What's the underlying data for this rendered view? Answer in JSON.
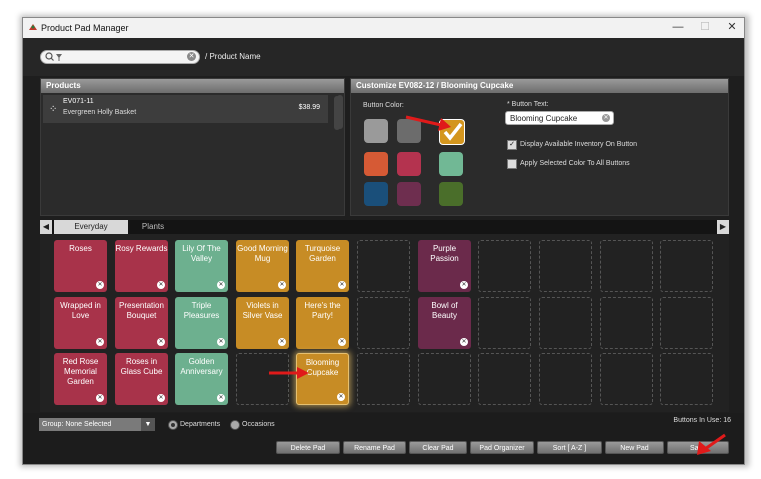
{
  "window": {
    "title": "Product Pad Manager",
    "controls": [
      "—",
      "☐",
      "✕"
    ]
  },
  "search": {
    "value": "",
    "placeholder": "",
    "label": "/ Product Name"
  },
  "products": {
    "header": "Products",
    "items": [
      {
        "code": "EV071-11",
        "name": "Evergreen Holly Basket",
        "price": "$38.99"
      }
    ]
  },
  "customize": {
    "header": "Customize EV082-12 / Blooming Cupcake",
    "button_color_label": "Button Color:",
    "swatches": [
      "#9a9a9a",
      "#6c6c6c",
      "#d4961e",
      "#d65a35",
      "#b4334f",
      "#71b895",
      "#1a4f7a",
      "#6e2e4f",
      "#4a6e2a"
    ],
    "selected_swatch": 2,
    "button_text_label": "* Button Text:",
    "button_text_value": "Blooming Cupcake",
    "display_inventory_label": "Display Available Inventory On Button",
    "display_inventory_checked": true,
    "apply_color_label": "Apply Selected Color To All Buttons",
    "apply_color_checked": false
  },
  "tabs": [
    {
      "label": "Everyday",
      "active": true
    },
    {
      "label": "Plants",
      "active": false
    }
  ],
  "pads": [
    {
      "label": "Roses",
      "color": "#a8334a",
      "row": 0,
      "col": 0
    },
    {
      "label": "Rosy Rewards",
      "color": "#a8334a",
      "row": 0,
      "col": 1
    },
    {
      "label": "Lily Of The Valley",
      "color": "#6db08f",
      "row": 0,
      "col": 2
    },
    {
      "label": "Good Morning Mug",
      "color": "#c78c25",
      "row": 0,
      "col": 3
    },
    {
      "label": "Turquoise Garden",
      "color": "#c78c25",
      "row": 0,
      "col": 4
    },
    {
      "label": "Purple Passion",
      "color": "#6b2a4b",
      "row": 0,
      "col": 6
    },
    {
      "label": "Wrapped in Love",
      "color": "#a8334a",
      "row": 1,
      "col": 0
    },
    {
      "label": "Presentation Bouquet",
      "color": "#a8334a",
      "row": 1,
      "col": 1
    },
    {
      "label": "Triple Pleasures",
      "color": "#6db08f",
      "row": 1,
      "col": 2
    },
    {
      "label": "Violets in Silver Vase",
      "color": "#c78c25",
      "row": 1,
      "col": 3
    },
    {
      "label": "Here's the Party!",
      "color": "#c78c25",
      "row": 1,
      "col": 4
    },
    {
      "label": "Bowl of Beauty",
      "color": "#6b2a4b",
      "row": 1,
      "col": 6
    },
    {
      "label": "Red Rose Memorial Garden",
      "color": "#a8334a",
      "row": 2,
      "col": 0
    },
    {
      "label": "Roses in Glass Cube",
      "color": "#a8334a",
      "row": 2,
      "col": 1
    },
    {
      "label": "Golden Anniversary",
      "color": "#6db08f",
      "row": 2,
      "col": 2
    },
    {
      "label": "Blooming Cupcake",
      "color": "#c78c25",
      "row": 2,
      "col": 4,
      "selected": true
    }
  ],
  "bottom": {
    "group_label": "Group: None Selected",
    "departments_label": "Departments",
    "occasions_label": "Occasions",
    "buttons_in_use": "Buttons In Use: 16",
    "buttons": [
      "Delete Pad",
      "Rename Pad",
      "Clear Pad",
      "Pad Organizer",
      "Sort [ A-Z ]",
      "New Pad",
      "Save"
    ]
  },
  "colors": {
    "accent_arrow": "#e01a1a",
    "window_bg": "#1e1e1e"
  }
}
